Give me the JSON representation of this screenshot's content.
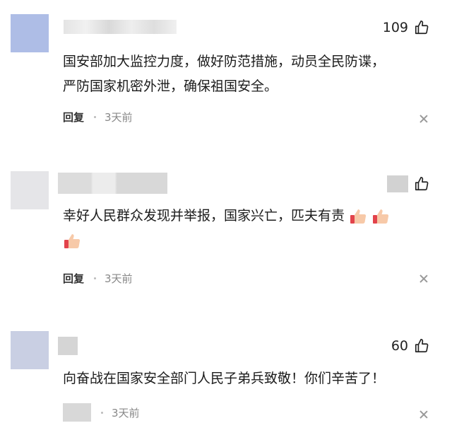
{
  "comments": [
    {
      "like_count": "109",
      "text_line1": "国安部加大监控力度，做好防范措施，动员全民防谍，",
      "text_line2": "严防国家机密外泄，确保祖国安全。",
      "reply_label": "回复",
      "time": "3天前",
      "avatar_color": "#aebde6"
    },
    {
      "like_count": "",
      "text_line1": "幸好人民群众发现并举报，国家兴亡，匹夫有责",
      "reply_label": "回复",
      "time": "3天前",
      "avatar_color": "#e3e3e7"
    },
    {
      "like_count": "60",
      "text_line1": "向奋战在国家安全部门人民子弟兵致敬！你们辛苦了！",
      "reply_label": "",
      "time": "3天前",
      "avatar_color": "#c9cfe3"
    }
  ],
  "icons": {
    "like": "thumbs-up-outline-icon",
    "close": "close-icon",
    "emoji": "thumbs-up-emoji-icon"
  }
}
